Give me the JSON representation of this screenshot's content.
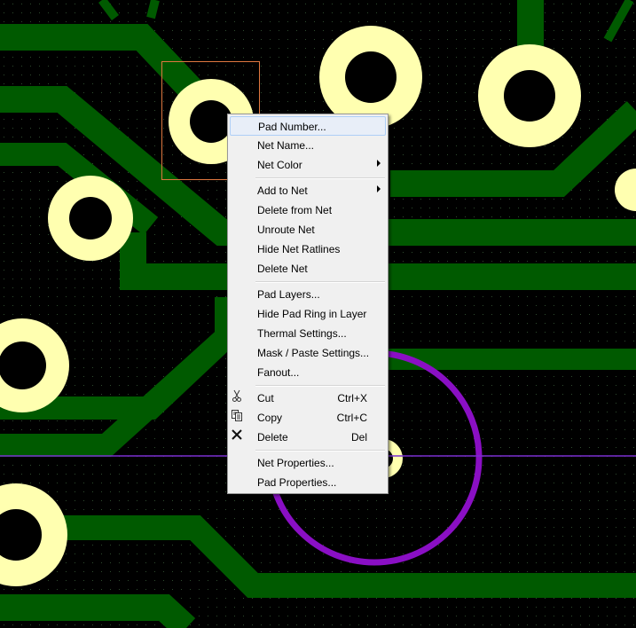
{
  "colors": {
    "background": "#000000",
    "trace": "#005a00",
    "pad": "#ffffb0",
    "selection_box": "#e07840",
    "circle": "#8a0fc4",
    "line": "#7a2fd0",
    "grid_dot": "#2e4a2e"
  },
  "context_menu": {
    "hovered_item": "Pad Number...",
    "items": [
      {
        "label": "Pad Number..."
      },
      {
        "label": "Net Name..."
      },
      {
        "label": "Net Color",
        "submenu": true
      },
      {
        "label": "Add to Net",
        "submenu": true
      },
      {
        "label": "Delete from Net"
      },
      {
        "label": "Unroute Net"
      },
      {
        "label": "Hide Net Ratlines"
      },
      {
        "label": "Delete Net"
      },
      {
        "label": "Pad Layers..."
      },
      {
        "label": "Hide Pad Ring in Layer"
      },
      {
        "label": "Thermal Settings..."
      },
      {
        "label": "Mask / Paste Settings..."
      },
      {
        "label": "Fanout..."
      },
      {
        "label": "Cut",
        "shortcut": "Ctrl+X",
        "icon": "scissors-icon"
      },
      {
        "label": "Copy",
        "shortcut": "Ctrl+C",
        "icon": "copy-icon"
      },
      {
        "label": "Delete",
        "shortcut": "Del",
        "icon": "delete-x-icon"
      },
      {
        "label": "Net Properties..."
      },
      {
        "label": "Pad Properties..."
      }
    ]
  }
}
